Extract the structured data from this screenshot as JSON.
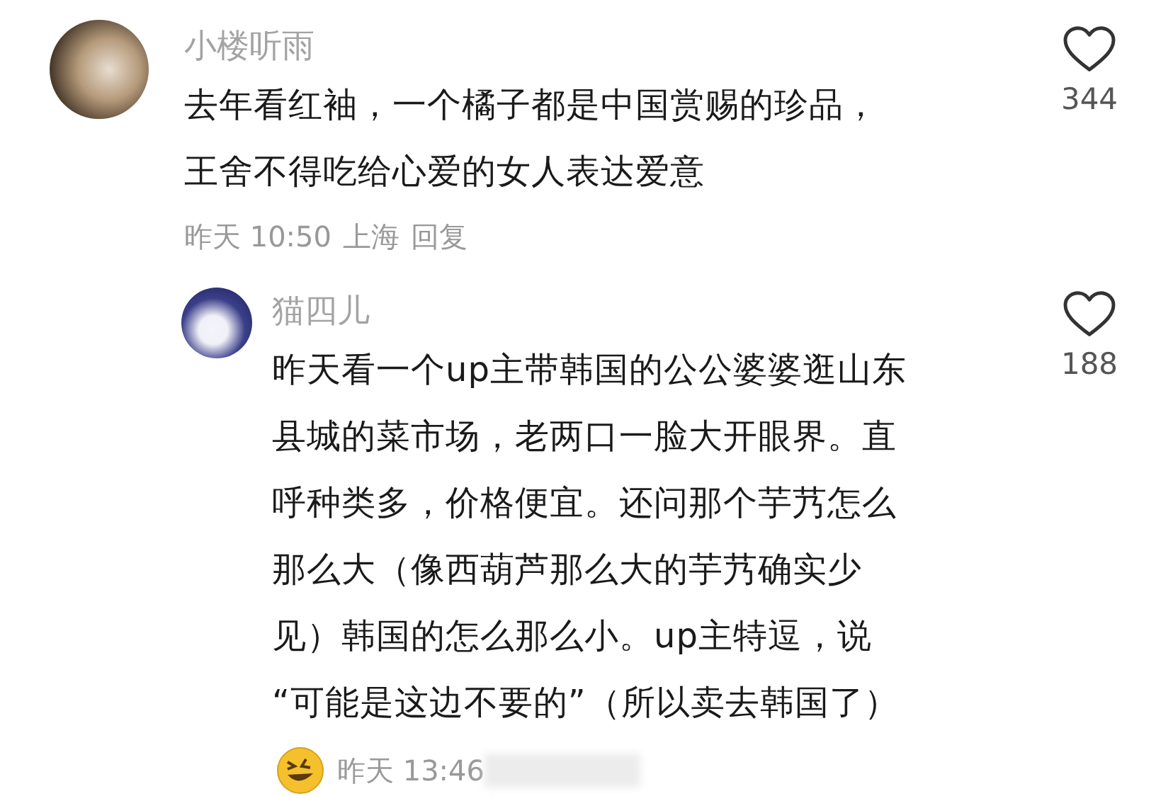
{
  "comments": [
    {
      "kind": "top",
      "user": "小楼听雨",
      "lines": [
        "去年看红袖，一个橘子都是中国赏赐的珍品，",
        "王舍不得吃给心爱的女人表达爱意"
      ],
      "time": "昨天 10:50",
      "location": "上海",
      "reply": "回复",
      "likes": "344"
    },
    {
      "kind": "reply",
      "user": "猫四儿",
      "lines": [
        "昨天看一个up主带韩国的公公婆婆逛山东",
        "县城的菜市场，老两口一脸大开眼界。直",
        "呼种类多，价格便宜。还问那个芋艿怎么",
        "那么大（像西葫芦那么大的芋艿确实少",
        "见）韩国的怎么那么小。up主特逗，说",
        "“可能是这边不要的”（所以卖去韩国了）"
      ],
      "time": "昨天 13:46",
      "likes": "188"
    }
  ]
}
